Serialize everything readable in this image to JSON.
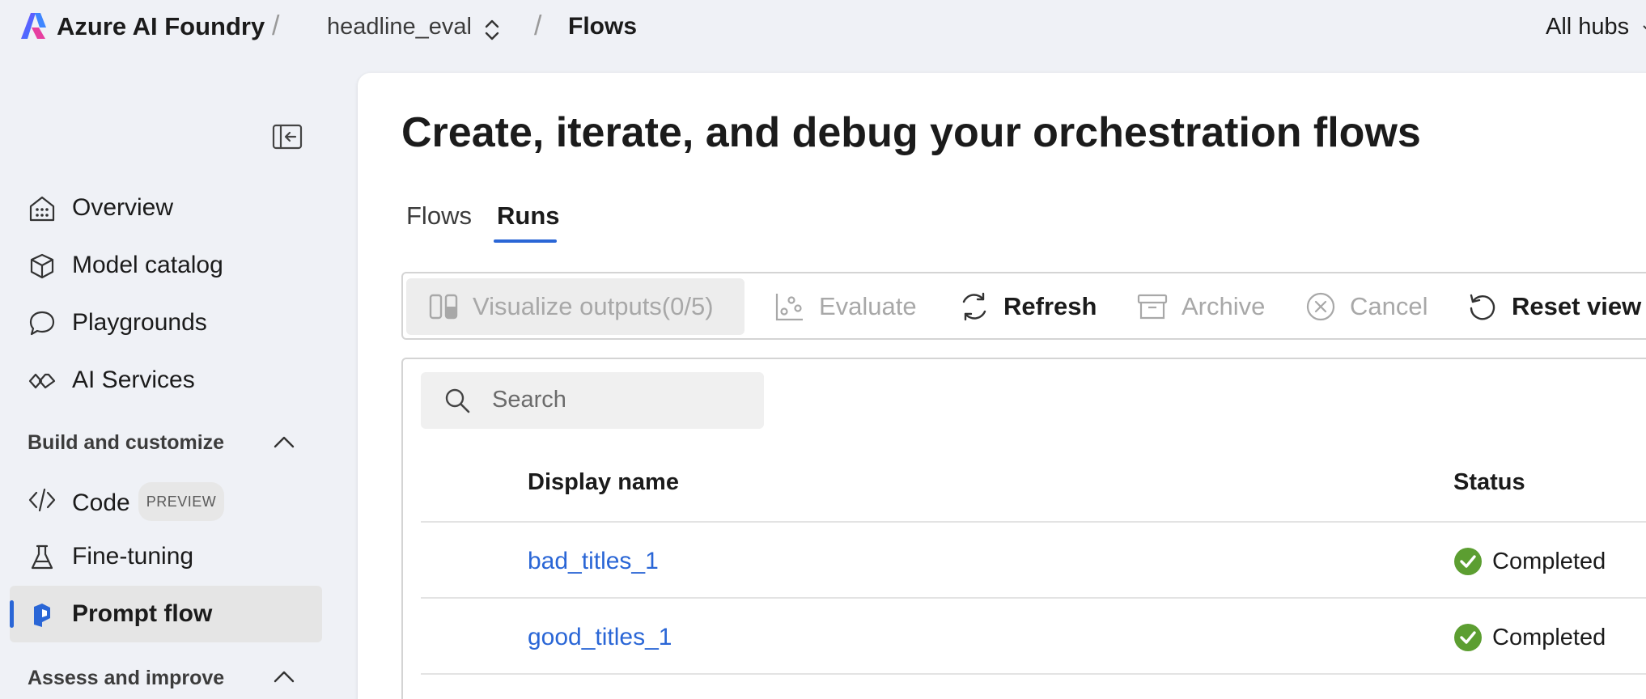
{
  "header": {
    "brand": "Azure AI Foundry",
    "project": "headline_eval",
    "current_page": "Flows",
    "hubs_label": "All hubs"
  },
  "sidebar": {
    "items": [
      {
        "label": "Overview",
        "icon": "home-grid-icon"
      },
      {
        "label": "Model catalog",
        "icon": "cube-icon"
      },
      {
        "label": "Playgrounds",
        "icon": "chat-bubbles-icon"
      },
      {
        "label": "AI Services",
        "icon": "link-icon"
      }
    ],
    "section_build": "Build and customize",
    "build_items": [
      {
        "label": "Code",
        "badge": "PREVIEW",
        "icon": "code-icon"
      },
      {
        "label": "Fine-tuning",
        "icon": "flask-icon"
      },
      {
        "label": "Prompt flow",
        "icon": "prompt-flow-icon",
        "active": true
      }
    ],
    "section_assess": "Assess and improve"
  },
  "main": {
    "title": "Create, iterate, and debug your orchestration flows",
    "tabs": [
      {
        "label": "Flows",
        "selected": false
      },
      {
        "label": "Runs",
        "selected": true
      }
    ],
    "toolbar": {
      "visualize": "Visualize outputs(0/5)",
      "evaluate": "Evaluate",
      "refresh": "Refresh",
      "archive": "Archive",
      "cancel": "Cancel",
      "reset_view": "Reset view"
    },
    "search_placeholder": "Search",
    "columns": {
      "display_name": "Display name",
      "status": "Status"
    },
    "rows": [
      {
        "name": "bad_titles_1",
        "status": "Completed"
      },
      {
        "name": "good_titles_1",
        "status": "Completed"
      }
    ]
  },
  "colors": {
    "accent": "#2a66d6",
    "success": "#5c9e31",
    "background": "#eff1f6"
  }
}
